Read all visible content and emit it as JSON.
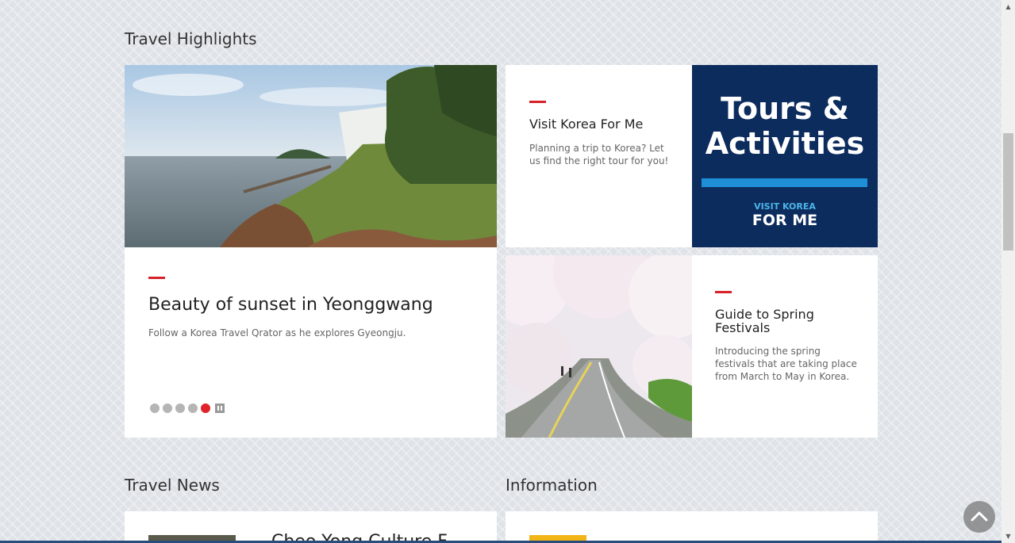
{
  "sections": {
    "highlights_title": "Travel Highlights",
    "news_title": "Travel News",
    "info_title": "Information"
  },
  "main_feature": {
    "title": "Beauty of sunset in Yeonggwang",
    "description": "Follow a Korea Travel Qrator as he explores Gyeongju.",
    "slides_count": 5,
    "active_slide": 5
  },
  "card_visitkorea": {
    "title": "Visit Korea For Me",
    "description": "Planning a trip to Korea? Let us find the right tour for you!"
  },
  "tours_banner": {
    "line1": "Tours &",
    "line2": "Activities",
    "brand": "VISIT KOREA",
    "logo": "FOR ME"
  },
  "card_spring": {
    "title": "Guide to Spring Festivals",
    "description": "Introducing the spring festivals that are taking place from March to May in Korea."
  },
  "news_preview": "Cheo Yong Culture F",
  "colors": {
    "accent": "#d7212b",
    "banner_bg": "#0d2c5e",
    "banner_bar": "#1e8fd6"
  },
  "icons": [
    "pause-icon",
    "chevron-up-icon"
  ]
}
